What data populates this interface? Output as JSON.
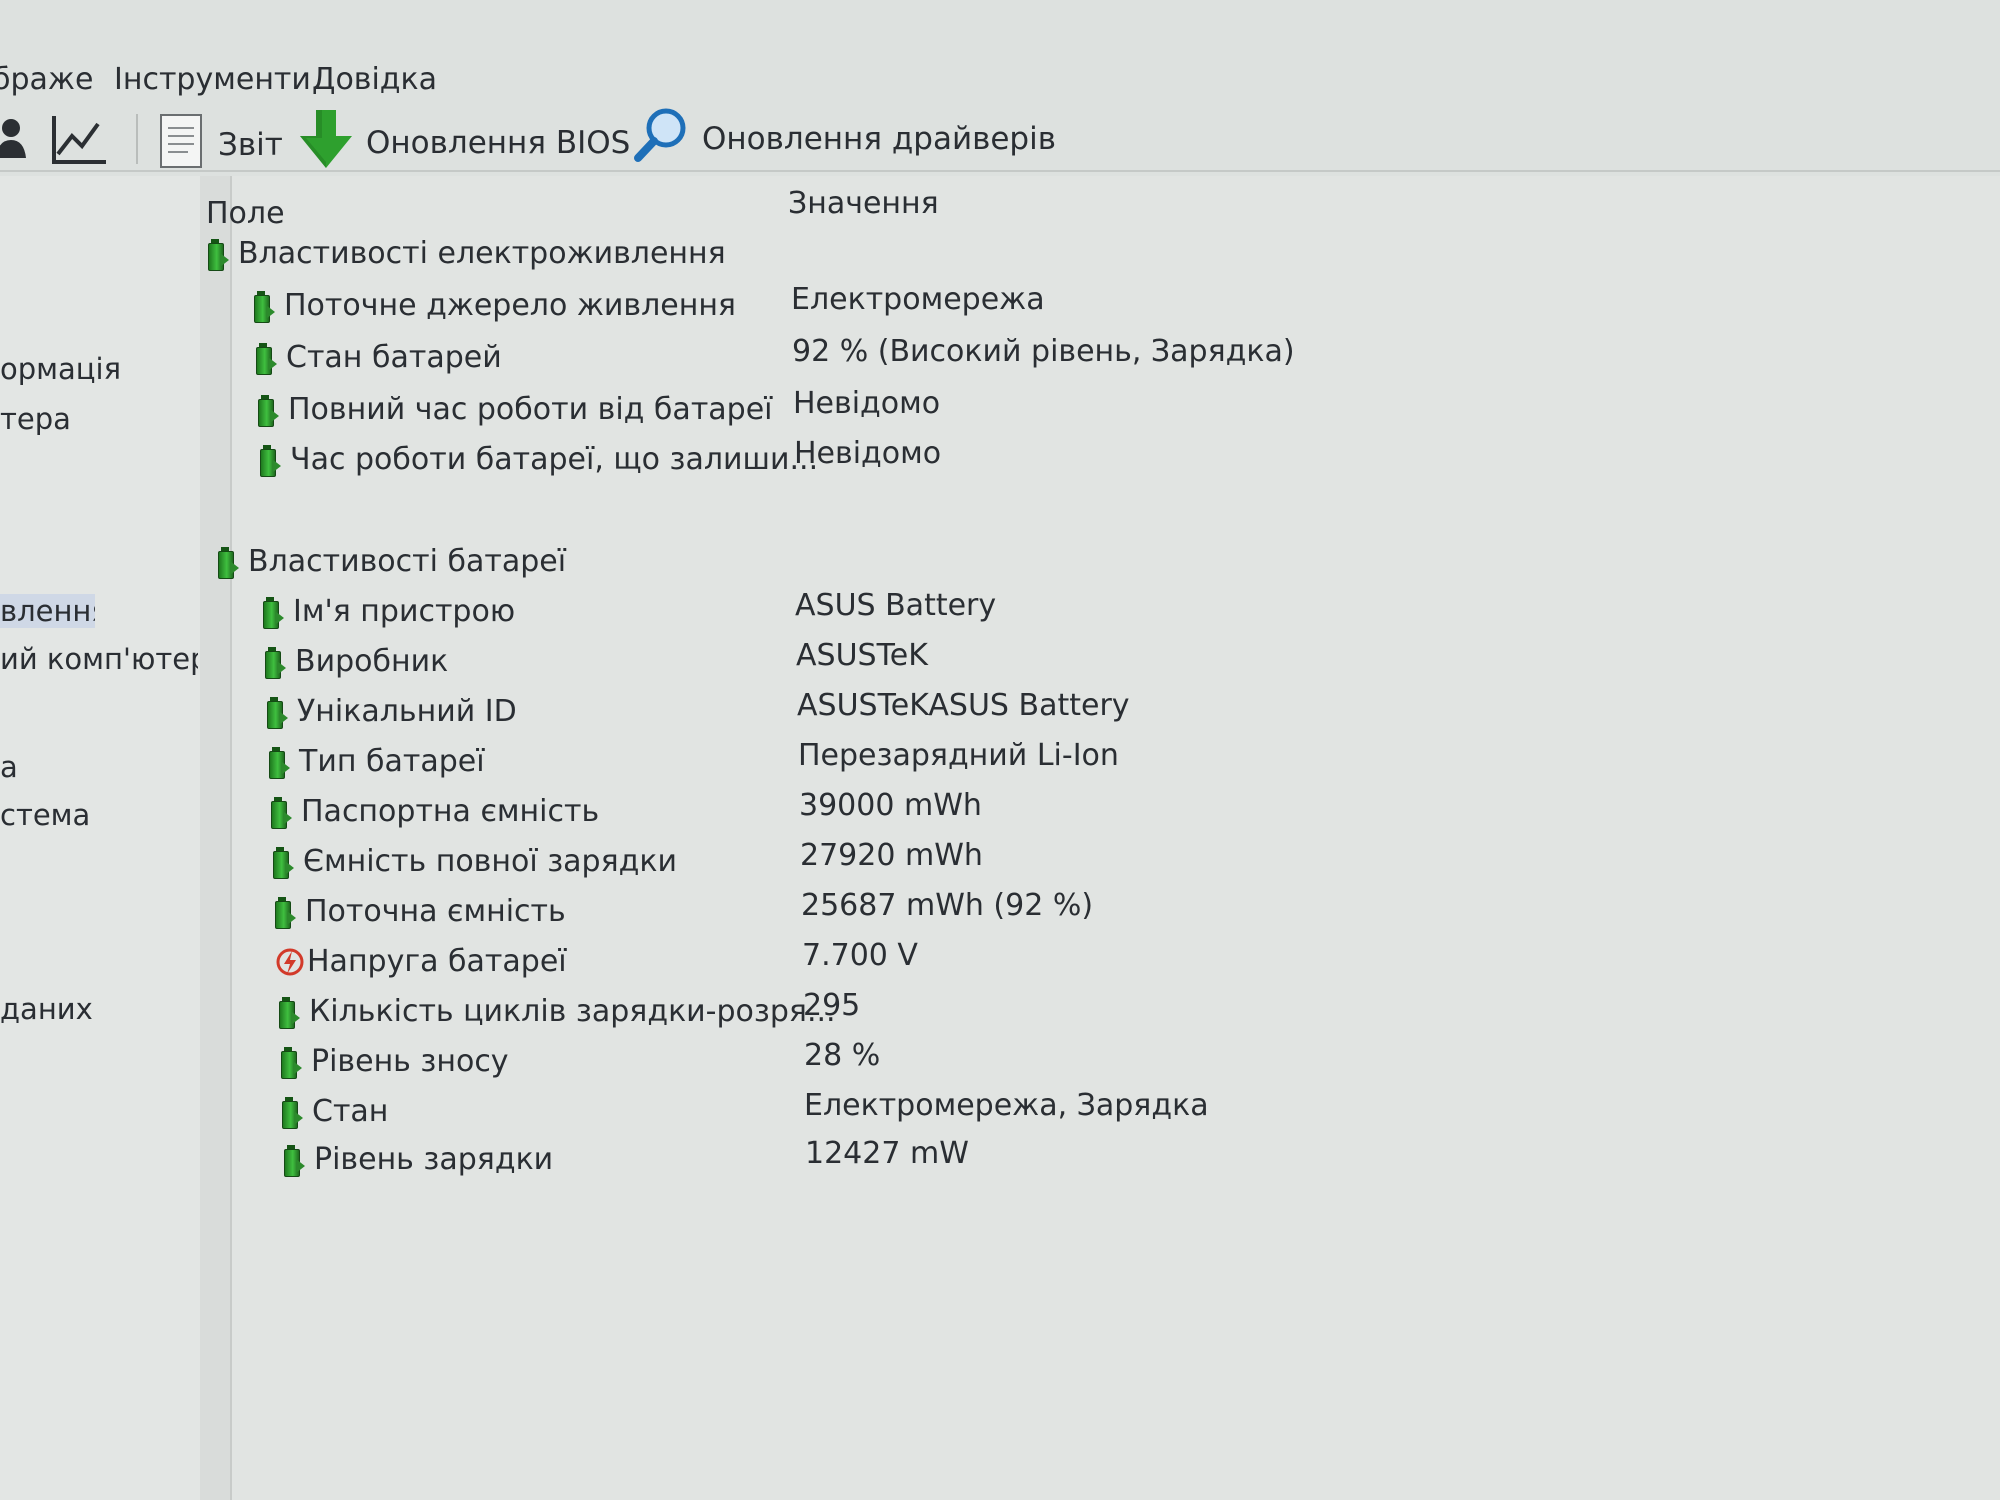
{
  "menu": [
    "браже",
    "Інструменти",
    "Довідка"
  ],
  "toolbar": {
    "report_label": "Звіт",
    "bios_update_label": "Оновлення BIOS",
    "driver_update_label": "Оновлення драйверів",
    "icons": [
      "user-icon",
      "chart-icon",
      "report-icon",
      "bios-download-icon",
      "driver-search-icon"
    ]
  },
  "sidebar": {
    "items": [
      {
        "label": "ормація",
        "selected": false
      },
      {
        "label": "тера",
        "selected": false
      },
      {
        "label": "влення",
        "selected": true
      },
      {
        "label": "ий комп'ютер",
        "selected": false
      },
      {
        "label": "а",
        "selected": false
      },
      {
        "label": "стема",
        "selected": false
      },
      {
        "label": "даних",
        "selected": false
      }
    ]
  },
  "table": {
    "columns": [
      "Поле",
      "Значення"
    ],
    "rows": [
      {
        "field": "Властивості електроживлення",
        "value": "",
        "icon": "battery-icon",
        "group": true
      },
      {
        "field": "Поточне джерело живлення",
        "value": "Електромережа",
        "icon": "battery-icon"
      },
      {
        "field": "Стан батарей",
        "value": "92 % (Високий рівень, Зарядка)",
        "icon": "battery-icon"
      },
      {
        "field": "Повний час роботи від батареї",
        "value": "Невідомо",
        "icon": "battery-icon"
      },
      {
        "field": "Час роботи батареї, що залиши...",
        "value": "Невідомо",
        "icon": "battery-icon"
      },
      {
        "field": "Властивості батареї",
        "value": "",
        "icon": "battery-icon",
        "group": true
      },
      {
        "field": "Ім'я пристрою",
        "value": "ASUS Battery",
        "icon": "battery-icon"
      },
      {
        "field": "Виробник",
        "value": "ASUSTeK",
        "icon": "battery-icon"
      },
      {
        "field": "Унікальний ID",
        "value": "ASUSTeKASUS Battery",
        "icon": "battery-icon"
      },
      {
        "field": "Тип батареї",
        "value": "Перезарядний Li-Ion",
        "icon": "battery-icon"
      },
      {
        "field": "Паспортна ємність",
        "value": "39000 mWh",
        "icon": "battery-icon"
      },
      {
        "field": "Ємність повної зарядки",
        "value": "27920 mWh",
        "icon": "battery-icon"
      },
      {
        "field": "Поточна ємність",
        "value": "25687 mWh  (92 %)",
        "icon": "battery-icon"
      },
      {
        "field": "Напруга батареї",
        "value": "7.700 V",
        "icon": "voltage-icon"
      },
      {
        "field": "Кількість циклів зарядки-розря...",
        "value": "295",
        "icon": "battery-icon"
      },
      {
        "field": "Рівень зносу",
        "value": "28 %",
        "icon": "battery-icon"
      },
      {
        "field": "Стан",
        "value": "Електромережа, Зарядка",
        "icon": "battery-icon"
      },
      {
        "field": "Рівень зарядки",
        "value": "12427 mW",
        "icon": "battery-icon"
      }
    ]
  },
  "colors": {
    "background": "#dde1df",
    "text": "#2a2e33",
    "battery_green": "#2f9e2f",
    "voltage_red": "#d23a2a",
    "selection": "#cfd8e6"
  }
}
